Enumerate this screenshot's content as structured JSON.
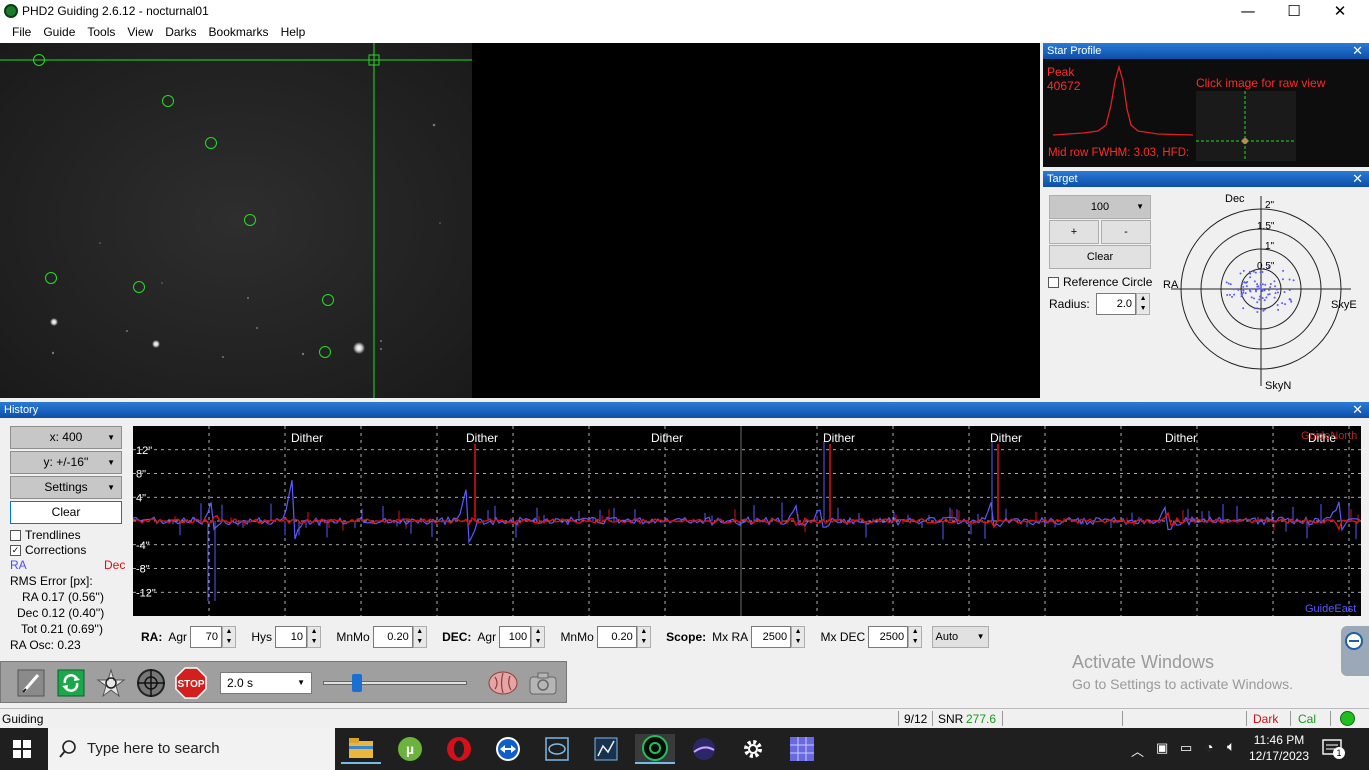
{
  "window": {
    "title": "PHD2 Guiding 2.6.12 - nocturnal01",
    "minimize": "—",
    "maximize": "☐",
    "close": "✕"
  },
  "menu": [
    "File",
    "Guide",
    "Tools",
    "View",
    "Darks",
    "Bookmarks",
    "Help"
  ],
  "star_profile": {
    "title": "Star Profile",
    "peak_label": "Peak",
    "peak_value": "40672",
    "click_hint": "Click image for raw view",
    "fwhm": "Mid row FWHM: 3.03, HFD:",
    "text_color": "#ff2a2a"
  },
  "target": {
    "title": "Target",
    "scale": "100",
    "plus": "+",
    "minus": "-",
    "clear": "Clear",
    "reference_circle": "Reference Circle",
    "reference_checked": false,
    "radius_label": "Radius:",
    "radius_value": "2.0",
    "labels": {
      "dec": "Dec",
      "ra": "RA",
      "skye": "SkyE",
      "skyn": "SkyN"
    },
    "ring_labels": [
      "2\"",
      "1.5\"",
      "1\"",
      "0.5\""
    ]
  },
  "history": {
    "title": "History",
    "x_scale": "x: 400",
    "y_scale": "y: +/-16''",
    "settings": "Settings",
    "clear": "Clear",
    "trendlines": "Trendlines",
    "trendlines_checked": false,
    "corrections": "Corrections",
    "corrections_checked": true,
    "legend_ra": "RA",
    "legend_dec": "Dec",
    "rms_title": "RMS Error [px]:",
    "rms_ra": "RA  0.17 (0.56'')",
    "rms_dec": "Dec  0.12 (0.40'')",
    "rms_tot": "Tot  0.21 (0.69'')",
    "ra_osc": "RA Osc: 0.23",
    "y_ticks": [
      "12\"",
      "8\"",
      "4\"",
      "-4\"",
      "-8\"",
      "-12\""
    ],
    "dither_labels": [
      "Dither",
      "Dither",
      "Dither",
      "Dither",
      "Dither",
      "Dither",
      "Dithe"
    ],
    "guide_north": "GuideNorth",
    "guide_east": "GuideEast",
    "ra_color": "#5a5aff",
    "dec_color": "#e01010"
  },
  "params": {
    "ra_label": "RA:",
    "agr_label": "Agr",
    "ra_agr": "70",
    "hys_label": "Hys",
    "ra_hys": "10",
    "mnmo_label": "MnMo",
    "ra_mnmo": "0.20",
    "dec_label": "DEC:",
    "dec_agr": "100",
    "dec_mnmo": "0.20",
    "scope_label": "Scope:",
    "mxra_label": "Mx RA",
    "mx_ra": "2500",
    "mxdec_label": "Mx DEC",
    "mx_dec": "2500",
    "mode": "Auto"
  },
  "toolbar": {
    "exposure": "2.0 s",
    "stop": "STOP",
    "exposure_fraction": 0.2
  },
  "watermark": {
    "line1": "Activate Windows",
    "line2": "Go to Settings to activate Windows."
  },
  "status": {
    "state": "Guiding",
    "frames": "9/12",
    "snr_label": "SNR",
    "snr_value": "277.6",
    "dark": "Dark",
    "cal": "Cal"
  },
  "taskbar": {
    "search_placeholder": "Type here to search",
    "time": "11:46 PM",
    "date": "12/17/2023",
    "notif_count": "1"
  }
}
